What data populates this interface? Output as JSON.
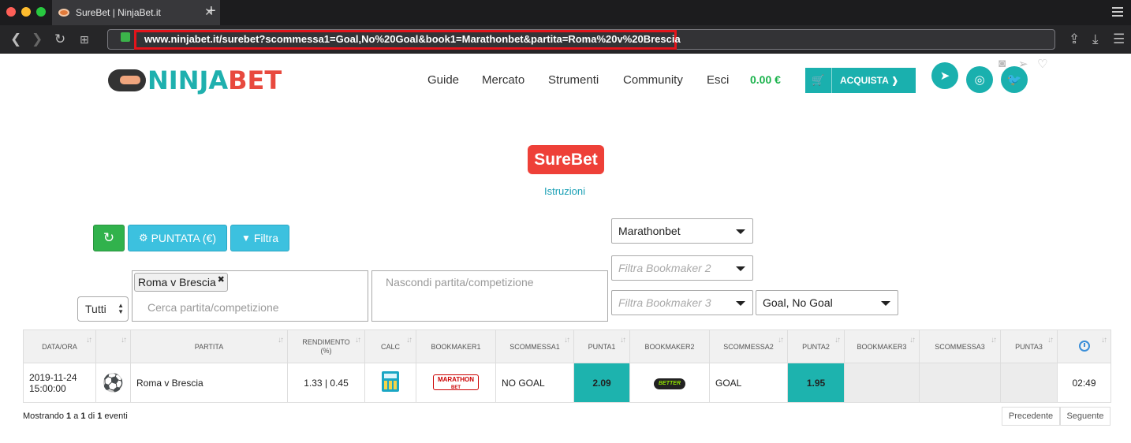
{
  "browser": {
    "tab_title": "SureBet | NinjaBet.it",
    "url": "www.ninjabet.it/surebet?scommessa1=Goal,No%20Goal&book1=Marathonbet&partita=Roma%20v%20Brescia"
  },
  "header": {
    "logo_ninja": "NINJA",
    "logo_bet": "BET",
    "nav": [
      "Guide",
      "Mercato",
      "Strumenti",
      "Community",
      "Esci"
    ],
    "balance": "0.00 €",
    "buy_label": "ACQUISTA ❱",
    "social_icons": [
      "telegram-icon",
      "instagram-icon",
      "twitter-icon"
    ]
  },
  "page": {
    "title_badge": "SureBet",
    "instructions_link": "Istruzioni",
    "refresh_icon": "↻",
    "puntata_label": "PUNTATA (€)",
    "filtra_label": "Filtra",
    "bookmaker1_value": "Marathonbet",
    "bookmaker2_placeholder": "Filtra Bookmaker 2",
    "bookmaker3_placeholder": "Filtra Bookmaker 3",
    "market_value": "Goal, No Goal",
    "scope_value": "Tutti",
    "search_chip": "Roma v Brescia",
    "search_placeholder": "Cerca partita/competizione",
    "hide_placeholder": "Nascondi partita/competizione"
  },
  "table": {
    "headers": [
      "DATA/ORA",
      "",
      "PARTITA",
      "RENDIMENTO (%)",
      "CALC",
      "BOOKMAKER1",
      "SCOMMESSA1",
      "PUNTA1",
      "BOOKMAKER2",
      "SCOMMESSA2",
      "PUNTA2",
      "BOOKMAKER3",
      "SCOMMESSA3",
      "PUNTA3",
      ""
    ],
    "rows": [
      {
        "date": "2019-11-24",
        "time": "15:00:00",
        "sport_icon": "⚽",
        "match": "Roma v Brescia",
        "yield": "1.33 | 0.45",
        "bookmaker1_logo_line1": "MARATHON",
        "bookmaker1_logo_line2": "BET",
        "bet1": "NO GOAL",
        "odd1": "2.09",
        "bookmaker2_logo": "BETTER",
        "bet2": "GOAL",
        "odd2": "1.95",
        "countdown": "02:49"
      }
    ]
  },
  "footer": {
    "showing_prefix": "Mostrando",
    "from": "1",
    "mid1": "a",
    "to": "1",
    "mid2": "di",
    "total": "1",
    "suffix": "eventi",
    "prev_label": "Precedente",
    "next_label": "Seguente"
  },
  "colors": {
    "brand_teal": "#1ab0ae",
    "brand_red": "#ee4038",
    "balance_green": "#19b24b",
    "url_highlight": "#e3141b"
  }
}
